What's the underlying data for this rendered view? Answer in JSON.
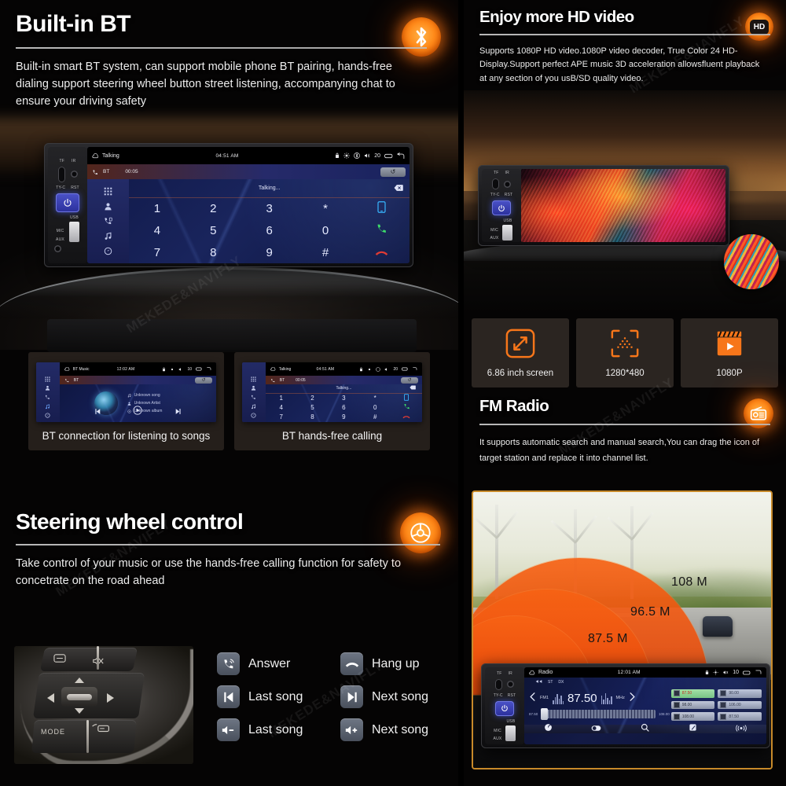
{
  "left_panel": {
    "bluetooth": {
      "title": "Built-in BT",
      "badge_icon": "bluetooth-icon",
      "description": "Built-in smart BT system, can support mobile phone BT pairing, hands-free dialing support steering wheel button street listening, accompanying chat to ensure your driving safety"
    },
    "main_screen": {
      "status_app": "Talking",
      "status_time": "04:51 AM",
      "status_volume": "20",
      "sub_source": "BT",
      "sub_timer": "00:05",
      "call_state": "Talking...",
      "keys": [
        "1",
        "2",
        "3",
        "*",
        "phone-blue",
        "4",
        "5",
        "6",
        "0",
        "call-green",
        "7",
        "8",
        "9",
        "#",
        "hangup-red"
      ],
      "rail_icons": [
        "apps-icon",
        "contacts-icon",
        "call-log-icon",
        "music-icon",
        "settings-icon"
      ]
    },
    "cards": [
      {
        "caption": "BT connection for listening to songs",
        "screen": {
          "status_app": "BT Music",
          "status_time": "12:02 AM",
          "status_volume": "10",
          "sub_source": "BT",
          "meta": [
            "Unknown song",
            "Unknown Artist",
            "Unknown album"
          ]
        }
      },
      {
        "caption": "BT hands-free calling",
        "screen": {
          "status_app": "Talking",
          "status_time": "04:51 AM",
          "status_volume": "20",
          "sub_source": "BT",
          "sub_timer": "00:05",
          "call_state": "Talking...",
          "keys": [
            "1",
            "2",
            "3",
            "*",
            "phone-blue",
            "4",
            "5",
            "6",
            "0",
            "call-green",
            "7",
            "8",
            "9",
            "#",
            "hangup-red"
          ]
        }
      }
    ],
    "steering": {
      "title": "Steering wheel control",
      "badge_icon": "steering-wheel-icon",
      "description": "Take control of your music or use the hands-free calling function for safety to concetrate on the road ahead",
      "photo_label": "MODE",
      "buttons": [
        {
          "label": "Answer",
          "icon": "answer-call-icon"
        },
        {
          "label": "Hang up",
          "icon": "hangup-call-icon"
        },
        {
          "label": "Last song",
          "icon": "previous-track-icon"
        },
        {
          "label": "Next song",
          "icon": "next-track-icon"
        },
        {
          "label": "Last song",
          "icon": "volume-down-icon"
        },
        {
          "label": "Next song",
          "icon": "volume-up-icon"
        }
      ]
    }
  },
  "right_panel": {
    "hd_video": {
      "title": "Enjoy more HD video",
      "badge_icon": "hd-icon",
      "badge_text": "HD",
      "description": "Supports 1080P HD video.1080P video decoder, True Color 24 HD-Display.Support perfect APE music 3D acceleration allowsfluent playback at any section of you usB/SD quality video."
    },
    "specs": [
      {
        "label": "6.86 inch screen",
        "icon": "expand-arrows-icon"
      },
      {
        "label": "1280*480",
        "icon": "resolution-focus-icon"
      },
      {
        "label": "1080P",
        "icon": "clapperboard-play-icon"
      }
    ],
    "fm_radio": {
      "title": "FM Radio",
      "badge_icon": "radio-icon",
      "description": "It supports automatic search and manual search,You can drag the icon of target station and replace it into channel list.",
      "wave_labels": [
        "108 M",
        "96.5 M",
        "87.5 M"
      ],
      "screen": {
        "status_app": "Radio",
        "status_time": "12:01 AM",
        "status_volume": "10",
        "band": "FM1",
        "frequency": "87.50",
        "unit": "MHz",
        "scale_min": "87.50",
        "scale_max": "108.00",
        "sub_labels": [
          "ST",
          "DX"
        ],
        "presets": [
          {
            "value": "87.50",
            "active": true
          },
          {
            "value": "90.00",
            "active": false
          },
          {
            "value": "98.00",
            "active": false
          },
          {
            "value": "106.00",
            "active": false
          },
          {
            "value": "108.00",
            "active": false
          },
          {
            "value": "87.50",
            "active": false
          }
        ],
        "toolbar_icons": [
          "power-scan-icon",
          "band-toggle-icon",
          "search-icon",
          "save-station-icon",
          "broadcast-icon"
        ]
      }
    }
  },
  "device": {
    "labels": {
      "tf": "TF",
      "ir": "IR",
      "typec": "TY-C",
      "rst": "RST",
      "mic": "MIC",
      "aux": "AUX",
      "usb": "USB"
    }
  },
  "watermark": "MEKEDE&NAVIFLY",
  "colors": {
    "accent": "#f7761a",
    "panel_bg": "#050404",
    "screen_blue": "#16205a",
    "card_bg": "#3a302a",
    "fm_border": "#c88a2a"
  }
}
